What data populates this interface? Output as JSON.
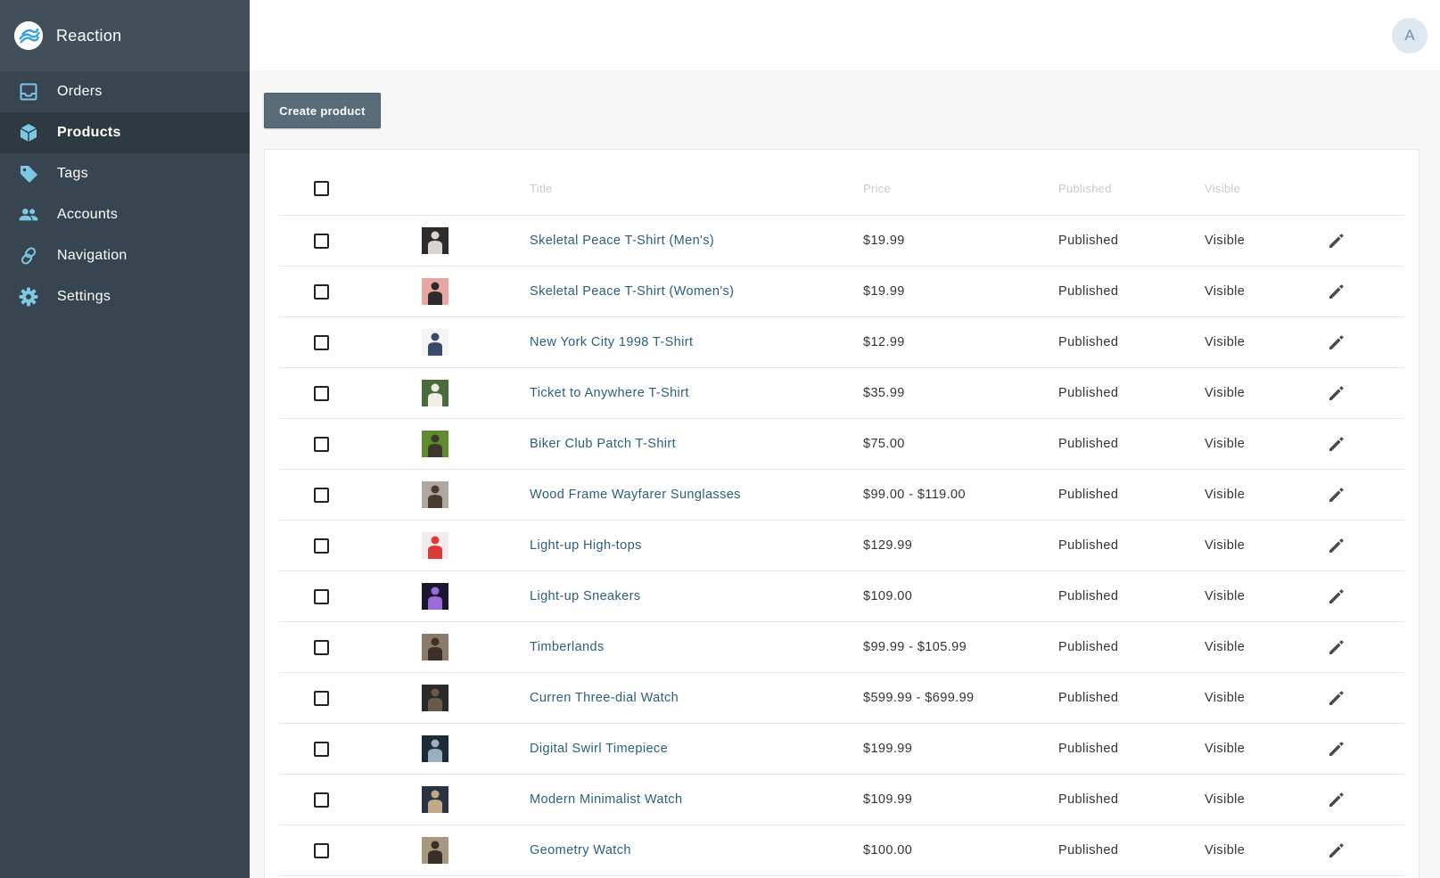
{
  "app": {
    "name": "Reaction",
    "avatar_initial": "A"
  },
  "sidebar": {
    "items": [
      {
        "label": "Orders",
        "icon": "inbox-icon",
        "active": false
      },
      {
        "label": "Products",
        "icon": "cube-icon",
        "active": true
      },
      {
        "label": "Tags",
        "icon": "tag-icon",
        "active": false
      },
      {
        "label": "Accounts",
        "icon": "people-icon",
        "active": false
      },
      {
        "label": "Navigation",
        "icon": "link-icon",
        "active": false
      },
      {
        "label": "Settings",
        "icon": "gear-icon",
        "active": false
      }
    ]
  },
  "toolbar": {
    "create_label": "Create product"
  },
  "table": {
    "headers": {
      "title": "Title",
      "price": "Price",
      "published": "Published",
      "visible": "Visible"
    },
    "rows": [
      {
        "title": "Skeletal Peace T-Shirt (Men's)",
        "price": "$19.99",
        "published": "Published",
        "visible": "Visible",
        "thumb_colors": [
          "#2e2a27",
          "#d9d4cf"
        ]
      },
      {
        "title": "Skeletal Peace T-Shirt (Women's)",
        "price": "$19.99",
        "published": "Published",
        "visible": "Visible",
        "thumb_colors": [
          "#e8a7a0",
          "#2b2b2b"
        ]
      },
      {
        "title": "New York City 1998 T-Shirt",
        "price": "$12.99",
        "published": "Published",
        "visible": "Visible",
        "thumb_colors": [
          "#f4f4f4",
          "#3a4a6a"
        ]
      },
      {
        "title": "Ticket to Anywhere T-Shirt",
        "price": "$35.99",
        "published": "Published",
        "visible": "Visible",
        "thumb_colors": [
          "#4a6b3a",
          "#f0ede8"
        ]
      },
      {
        "title": "Biker Club Patch T-Shirt",
        "price": "$75.00",
        "published": "Published",
        "visible": "Visible",
        "thumb_colors": [
          "#5f8a2e",
          "#3b3a2a"
        ]
      },
      {
        "title": "Wood Frame Wayfarer Sunglasses",
        "price": "$99.00 - $119.00",
        "published": "Published",
        "visible": "Visible",
        "thumb_colors": [
          "#b0a8a0",
          "#4a3a30"
        ]
      },
      {
        "title": "Light-up High-tops",
        "price": "$129.99",
        "published": "Published",
        "visible": "Visible",
        "thumb_colors": [
          "#f3ecec",
          "#d93a3a"
        ]
      },
      {
        "title": "Light-up Sneakers",
        "price": "$109.00",
        "published": "Published",
        "visible": "Visible",
        "thumb_colors": [
          "#1c1530",
          "#9a6ad8"
        ]
      },
      {
        "title": "Timberlands",
        "price": "$99.99 - $105.99",
        "published": "Published",
        "visible": "Visible",
        "thumb_colors": [
          "#8a7a6a",
          "#3a3028"
        ]
      },
      {
        "title": "Curren Three-dial Watch",
        "price": "$599.99 - $699.99",
        "published": "Published",
        "visible": "Visible",
        "thumb_colors": [
          "#2a2a2a",
          "#6a5a4a"
        ]
      },
      {
        "title": "Digital Swirl Timepiece",
        "price": "$199.99",
        "published": "Published",
        "visible": "Visible",
        "thumb_colors": [
          "#1e2a36",
          "#9ab0c0"
        ]
      },
      {
        "title": "Modern Minimalist Watch",
        "price": "$109.99",
        "published": "Published",
        "visible": "Visible",
        "thumb_colors": [
          "#2a3440",
          "#c0a888"
        ]
      },
      {
        "title": "Geometry Watch",
        "price": "$100.00",
        "published": "Published",
        "visible": "Visible",
        "thumb_colors": [
          "#a89880",
          "#3a3028"
        ]
      }
    ]
  },
  "colors": {
    "sidebar_bg": "#36454f",
    "brand_bg": "#414f58",
    "active_item_bg": "#2d3a41",
    "icon_accent": "#7ec8e3",
    "link": "#2c5e7e",
    "button_bg": "#5a6c78"
  }
}
